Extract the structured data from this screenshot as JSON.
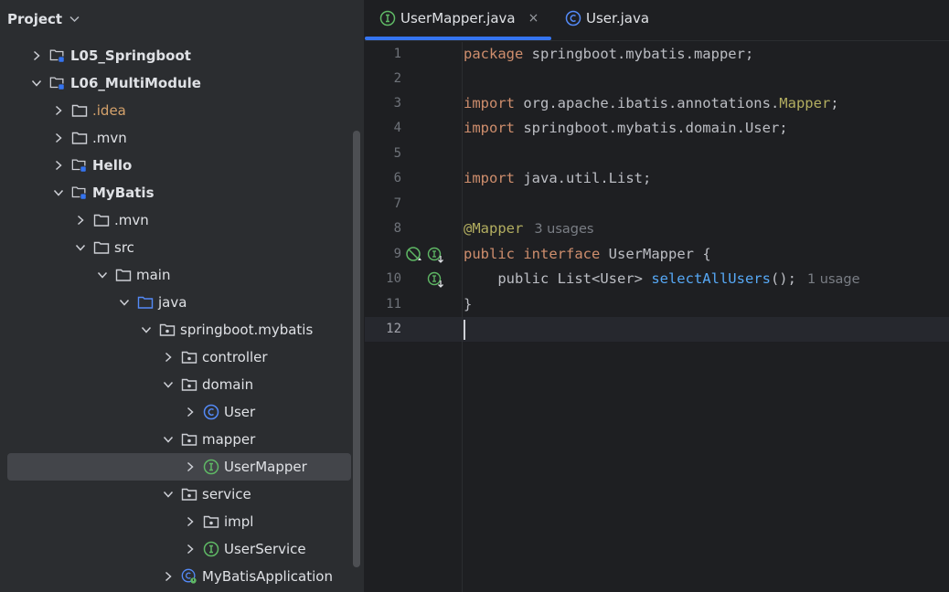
{
  "project_panel": {
    "title": "Project",
    "tree": [
      {
        "label": "L05_Springboot",
        "style": "bold",
        "icon": "module-folder-icon",
        "arrow": "right"
      },
      {
        "label": "L06_MultiModule",
        "style": "bold",
        "icon": "module-folder-icon",
        "arrow": "down"
      },
      {
        "label": ".idea",
        "style": "orange",
        "icon": "folder-icon",
        "arrow": "right"
      },
      {
        "label": ".mvn",
        "style": "normal",
        "icon": "folder-icon",
        "arrow": "right"
      },
      {
        "label": "Hello",
        "style": "bold",
        "icon": "module-folder-icon",
        "arrow": "right"
      },
      {
        "label": "MyBatis",
        "style": "bold",
        "icon": "module-folder-icon",
        "arrow": "down"
      },
      {
        "label": ".mvn",
        "style": "normal",
        "icon": "folder-icon",
        "arrow": "right"
      },
      {
        "label": "src",
        "style": "normal",
        "icon": "folder-icon",
        "arrow": "down"
      },
      {
        "label": "main",
        "style": "normal",
        "icon": "folder-icon",
        "arrow": "down"
      },
      {
        "label": "java",
        "style": "normal",
        "icon": "source-folder-icon",
        "arrow": "down"
      },
      {
        "label": "springboot.mybatis",
        "style": "normal",
        "icon": "package-icon",
        "arrow": "down"
      },
      {
        "label": "controller",
        "style": "normal",
        "icon": "package-icon",
        "arrow": "right"
      },
      {
        "label": "domain",
        "style": "normal",
        "icon": "package-icon",
        "arrow": "down"
      },
      {
        "label": "User",
        "style": "normal",
        "icon": "class-icon",
        "arrow": "right"
      },
      {
        "label": "mapper",
        "style": "normal",
        "icon": "package-icon",
        "arrow": "down"
      },
      {
        "label": "UserMapper",
        "style": "normal",
        "icon": "interface-icon",
        "arrow": "right",
        "selected": true
      },
      {
        "label": "service",
        "style": "normal",
        "icon": "package-icon",
        "arrow": "down"
      },
      {
        "label": "impl",
        "style": "normal",
        "icon": "package-icon",
        "arrow": "right"
      },
      {
        "label": "UserService",
        "style": "normal",
        "icon": "interface-icon",
        "arrow": "right"
      },
      {
        "label": "MyBatisApplication",
        "style": "normal",
        "icon": "spring-boot-class-icon",
        "arrow": "right"
      }
    ]
  },
  "editor": {
    "tabs": [
      {
        "label": "UserMapper.java",
        "icon": "interface-icon",
        "active": true,
        "close": "×"
      },
      {
        "label": "User.java",
        "icon": "class-icon",
        "active": false
      }
    ],
    "line_numbers": [
      "1",
      "2",
      "3",
      "4",
      "5",
      "6",
      "7",
      "8",
      "9",
      "10",
      "11",
      "12"
    ],
    "current_line": "12",
    "lines": {
      "l1": {
        "kw": "package",
        "rest": " springboot.mybatis.mapper;"
      },
      "l3": {
        "kw": "import",
        "rest": " org.apache.ibatis.annotations.",
        "ann": "Mapper",
        "end": ";"
      },
      "l4": {
        "kw": "import",
        "rest": " springboot.mybatis.domain.User;"
      },
      "l6": {
        "kw": "import",
        "rest": " java.util.List;"
      },
      "l8": {
        "ann": "@Mapper",
        "hint": "3 usages"
      },
      "l9": {
        "kw1": "public",
        "kw2": "interface",
        "rest": " UserMapper {"
      },
      "l10": {
        "kw": "public",
        "type": " List<User> ",
        "fn": "selectAllUsers",
        "end": "();",
        "hint": "1 usage"
      },
      "l11": {
        "text": "}"
      }
    },
    "gutter_icons": [
      "no-implementation-icon",
      "interface-implementations-icon",
      "method-implementations-icon"
    ]
  },
  "colors": {
    "accent": "#3574f0",
    "keyword": "#cf8e6d",
    "annotation": "#b3ae60",
    "function": "#56a8f5"
  }
}
